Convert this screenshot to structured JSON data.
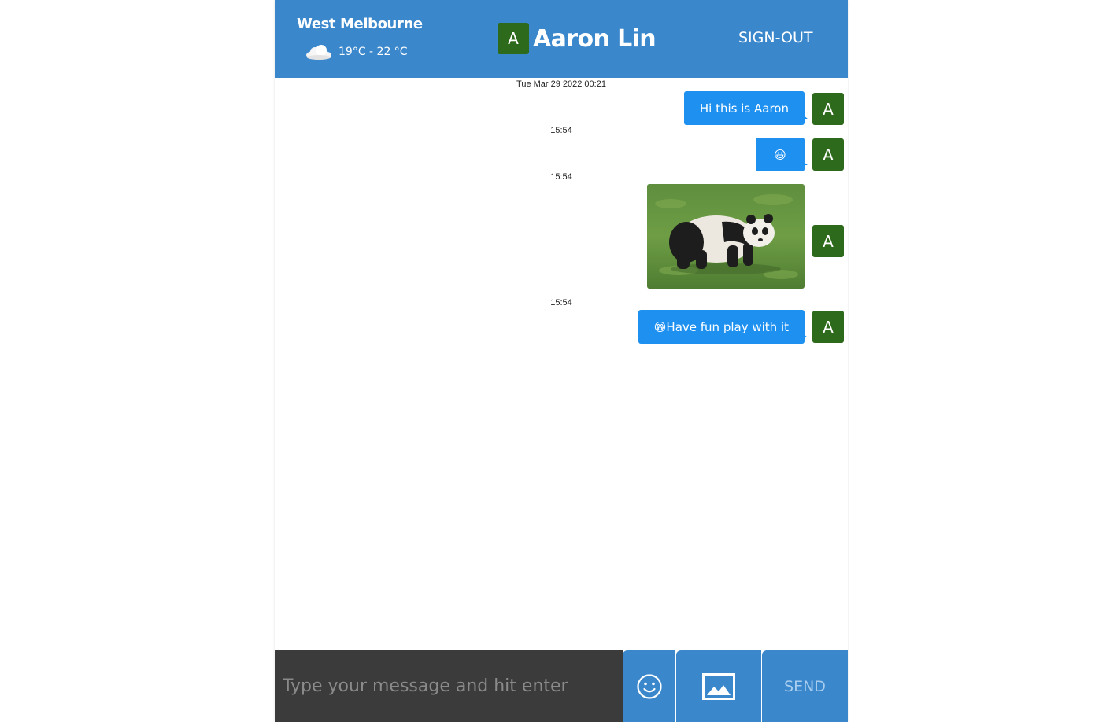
{
  "header": {
    "location": "West Melbourne",
    "weather_icon": "cloud-icon",
    "temperature": "19°C - 22 °C",
    "user_initial": "A",
    "user_name": "Aaron Lin",
    "signout_label": "SIGN-OUT",
    "background_color": "#3a87cc"
  },
  "messages": {
    "date_header": "Tue Mar 29 2022 00:21",
    "items": [
      {
        "type": "text",
        "text": "Hi this is Aaron",
        "time": "15:54",
        "avatar_initial": "A"
      },
      {
        "type": "emoji",
        "text": "😃",
        "time": "15:54",
        "avatar_initial": "A"
      },
      {
        "type": "image",
        "image_subject": "panda-photo",
        "time": "15:54",
        "avatar_initial": "A"
      },
      {
        "type": "text",
        "text": "😁Have fun play with it",
        "avatar_initial": "A"
      }
    ],
    "bubble_color": "#1e90f0",
    "avatar_color": "#2d6a1b"
  },
  "composer": {
    "placeholder": "Type your message and hit enter",
    "emoji_button_icon": "smiley-icon",
    "image_button_icon": "image-icon",
    "send_label": "SEND"
  }
}
